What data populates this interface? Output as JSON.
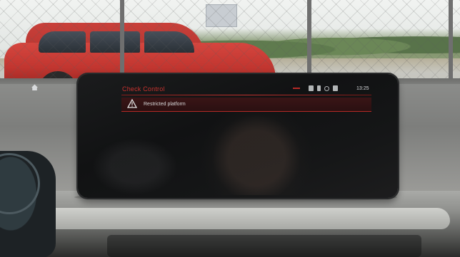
{
  "screen": {
    "title": "Check Control",
    "clock": "13:25",
    "accent_color": "#c8322e",
    "status_icons": [
      "media-icon",
      "phone-icon",
      "signal-icon",
      "settings-icon"
    ],
    "messages": [
      {
        "icon": "warning-triangle-icon",
        "text": "Restricted platform"
      }
    ]
  }
}
